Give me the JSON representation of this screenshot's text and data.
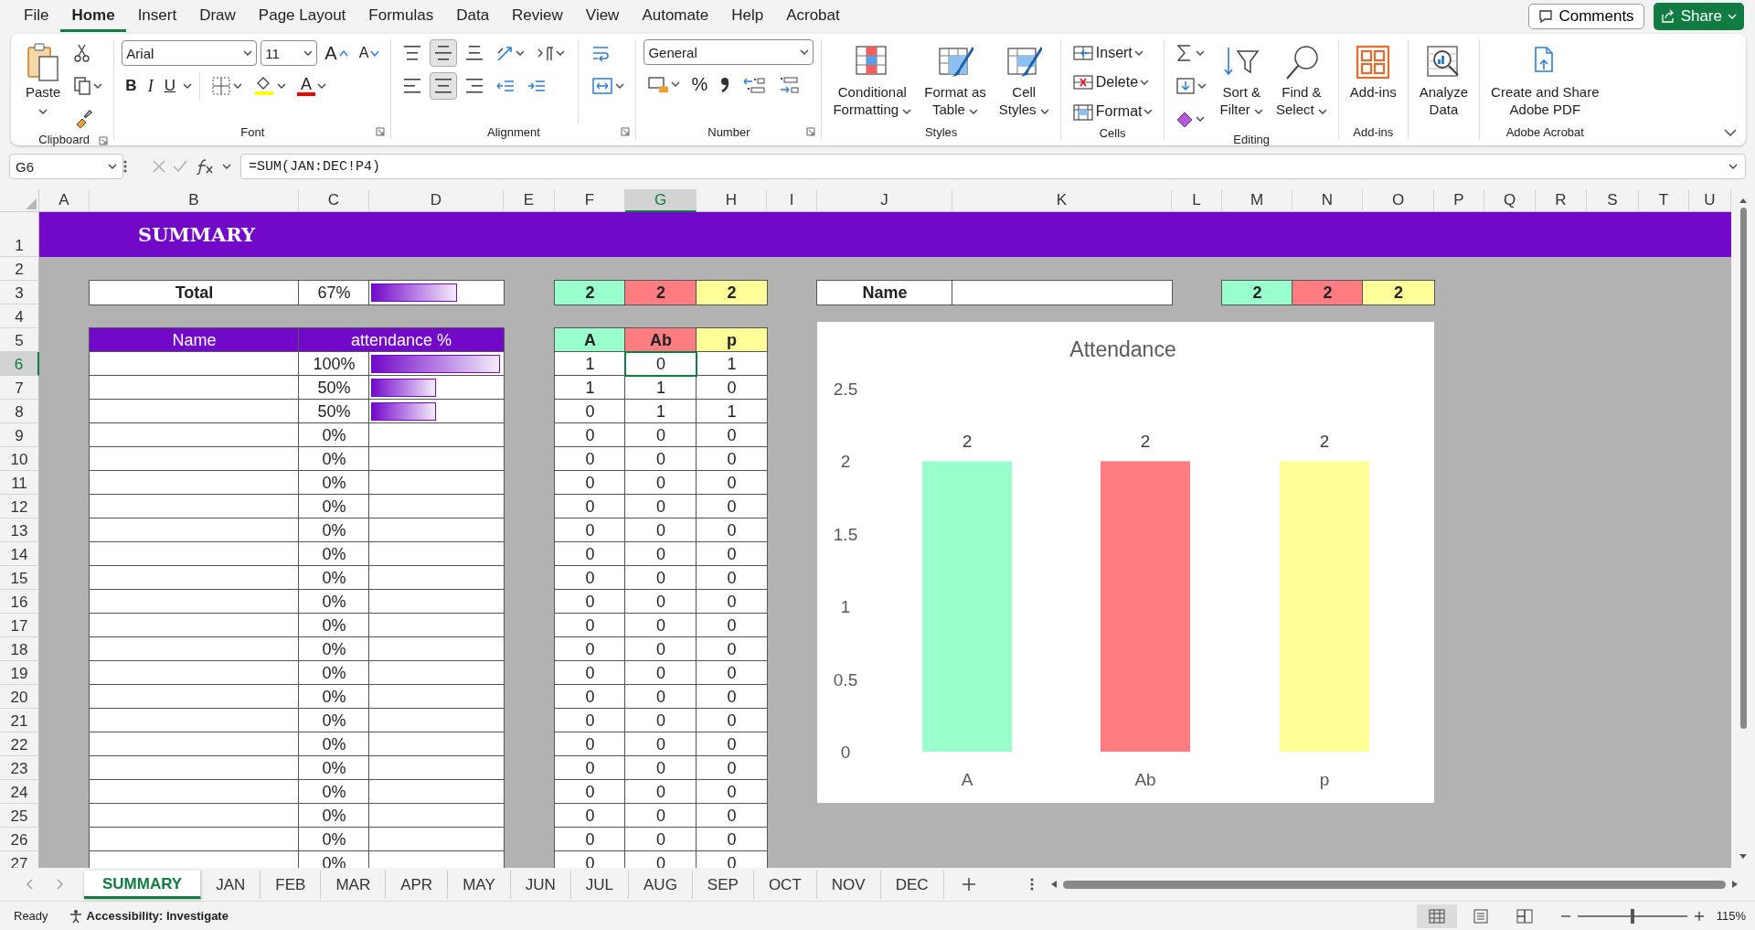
{
  "menu": {
    "tabs": [
      {
        "label": "File",
        "selected": false
      },
      {
        "label": "Home",
        "selected": true
      },
      {
        "label": "Insert",
        "selected": false
      },
      {
        "label": "Draw",
        "selected": false
      },
      {
        "label": "Page Layout",
        "selected": false
      },
      {
        "label": "Formulas",
        "selected": false
      },
      {
        "label": "Data",
        "selected": false
      },
      {
        "label": "Review",
        "selected": false
      },
      {
        "label": "View",
        "selected": false
      },
      {
        "label": "Automate",
        "selected": false
      },
      {
        "label": "Help",
        "selected": false
      },
      {
        "label": "Acrobat",
        "selected": false
      }
    ],
    "comments": "Comments",
    "share": "Share"
  },
  "ribbon": {
    "groups": [
      {
        "kind": "clipboard",
        "label": "Clipboard",
        "launcher": true,
        "paste": "Paste"
      },
      {
        "kind": "font",
        "label": "Font",
        "launcher": true,
        "font": "Arial",
        "size": "11",
        "grow": "A",
        "shrink": "A",
        "styles": [
          "B",
          "I",
          "U"
        ],
        "color_text": "A"
      },
      {
        "kind": "alignment",
        "label": "Alignment",
        "launcher": true,
        "vertical": [
          {
            "selected": false
          },
          {
            "selected": true
          },
          {
            "selected": false
          }
        ],
        "horizontal": [
          {
            "selected": false
          },
          {
            "selected": true
          },
          {
            "selected": false
          }
        ]
      },
      {
        "kind": "number",
        "label": "Number",
        "launcher": true,
        "format": "General",
        "percent": "%"
      },
      {
        "kind": "large",
        "label": "Styles",
        "launcher": false,
        "buttons": [
          {
            "lines": [
              "Conditional",
              "Formatting"
            ],
            "dropdown": true
          },
          {
            "lines": [
              "Format as",
              "Table"
            ],
            "dropdown": true
          },
          {
            "lines": [
              "Cell",
              "Styles"
            ],
            "dropdown": true
          }
        ]
      },
      {
        "kind": "cells",
        "label": "Cells",
        "launcher": false,
        "buttons": [
          {
            "text": "Insert",
            "dropdown": true
          },
          {
            "text": "Delete",
            "dropdown": true
          },
          {
            "text": "Format",
            "dropdown": true
          }
        ]
      },
      {
        "kind": "editing",
        "label": "Editing",
        "launcher": false,
        "buttons": [
          {
            "lines": [
              "Sort &",
              "Filter"
            ],
            "dropdown": true
          },
          {
            "lines": [
              "Find &",
              "Select"
            ],
            "dropdown": true
          }
        ]
      },
      {
        "kind": "large",
        "label": "Add-ins",
        "launcher": false,
        "buttons": [
          {
            "lines": [
              "Add-ins"
            ],
            "dropdown": false
          }
        ]
      },
      {
        "kind": "large",
        "launcher": false,
        "buttons": [
          {
            "lines": [
              "Analyze",
              "Data"
            ],
            "dropdown": false
          }
        ]
      },
      {
        "kind": "large",
        "label": "Adobe Acrobat",
        "launcher": false,
        "buttons": [
          {
            "lines": [
              "Create and Share",
              "Adobe PDF"
            ],
            "dropdown": false
          }
        ]
      }
    ]
  },
  "formula_bar": {
    "name_box": "G6",
    "formula": "=SUM(JAN:DEC!P4)"
  },
  "sheet": {
    "column_headers": [
      {
        "label": "A",
        "selected": false
      },
      {
        "label": "B",
        "selected": false
      },
      {
        "label": "C",
        "selected": false
      },
      {
        "label": "D",
        "selected": false
      },
      {
        "label": "E",
        "selected": false
      },
      {
        "label": "F",
        "selected": false
      },
      {
        "label": "G",
        "selected": true
      },
      {
        "label": "H",
        "selected": false
      },
      {
        "label": "I",
        "selected": false
      },
      {
        "label": "J",
        "selected": false
      },
      {
        "label": "K",
        "selected": false
      },
      {
        "label": "L",
        "selected": false
      },
      {
        "label": "M",
        "selected": false
      },
      {
        "label": "N",
        "selected": false
      },
      {
        "label": "O",
        "selected": false
      },
      {
        "label": "P",
        "selected": false
      },
      {
        "label": "Q",
        "selected": false
      },
      {
        "label": "R",
        "selected": false
      },
      {
        "label": "S",
        "selected": false
      },
      {
        "label": "T",
        "selected": false
      },
      {
        "label": "U",
        "selected": false
      }
    ],
    "row_headers": [
      {
        "label": "1",
        "selected": false
      },
      {
        "label": "2",
        "selected": false
      },
      {
        "label": "3",
        "selected": false
      },
      {
        "label": "4",
        "selected": false
      },
      {
        "label": "5",
        "selected": false
      },
      {
        "label": "6",
        "selected": true
      },
      {
        "label": "7",
        "selected": false
      },
      {
        "label": "8",
        "selected": false
      },
      {
        "label": "9",
        "selected": false
      },
      {
        "label": "10",
        "selected": false
      },
      {
        "label": "11",
        "selected": false
      },
      {
        "label": "12",
        "selected": false
      },
      {
        "label": "13",
        "selected": false
      },
      {
        "label": "14",
        "selected": false
      },
      {
        "label": "15",
        "selected": false
      },
      {
        "label": "16",
        "selected": false
      },
      {
        "label": "17",
        "selected": false
      },
      {
        "label": "18",
        "selected": false
      },
      {
        "label": "19",
        "selected": false
      },
      {
        "label": "20",
        "selected": false
      },
      {
        "label": "21",
        "selected": false
      },
      {
        "label": "22",
        "selected": false
      },
      {
        "label": "23",
        "selected": false
      },
      {
        "label": "24",
        "selected": false
      },
      {
        "label": "25",
        "selected": false
      },
      {
        "label": "26",
        "selected": false
      },
      {
        "label": "27",
        "selected": false
      }
    ],
    "title": "SUMMARY",
    "total": {
      "label": "Total",
      "percent": "67%",
      "level": 0.67
    },
    "totals": [
      "2",
      "2",
      "2"
    ],
    "lookup": {
      "label": "Name",
      "totals": [
        "2",
        "2",
        "2"
      ]
    },
    "table_headers": [
      "Name",
      "attendance %"
    ],
    "legend": [
      {
        "label": "A",
        "color": "#99ffcc"
      },
      {
        "label": "Ab",
        "color": "#ff7c80"
      },
      {
        "label": "p",
        "color": "#ffff99"
      }
    ],
    "rows": [
      {
        "percent": "100%",
        "level": 1,
        "counts": [
          {
            "value": "1",
            "selected": false
          },
          {
            "value": "0",
            "selected": true
          },
          {
            "value": "1",
            "selected": false
          }
        ]
      },
      {
        "percent": "50%",
        "level": 0.5,
        "counts": [
          {
            "value": "1",
            "selected": false
          },
          {
            "value": "1",
            "selected": false
          },
          {
            "value": "0",
            "selected": false
          }
        ]
      },
      {
        "percent": "50%",
        "level": 0.5,
        "counts": [
          {
            "value": "0",
            "selected": false
          },
          {
            "value": "1",
            "selected": false
          },
          {
            "value": "1",
            "selected": false
          }
        ]
      },
      {
        "percent": "0%",
        "counts": [
          {
            "value": "0",
            "selected": false
          },
          {
            "value": "0",
            "selected": false
          },
          {
            "value": "0",
            "selected": false
          }
        ]
      },
      {
        "percent": "0%",
        "counts": [
          {
            "value": "0",
            "selected": false
          },
          {
            "value": "0",
            "selected": false
          },
          {
            "value": "0",
            "selected": false
          }
        ]
      },
      {
        "percent": "0%",
        "counts": [
          {
            "value": "0",
            "selected": false
          },
          {
            "value": "0",
            "selected": false
          },
          {
            "value": "0",
            "selected": false
          }
        ]
      },
      {
        "percent": "0%",
        "counts": [
          {
            "value": "0",
            "selected": false
          },
          {
            "value": "0",
            "selected": false
          },
          {
            "value": "0",
            "selected": false
          }
        ]
      },
      {
        "percent": "0%",
        "counts": [
          {
            "value": "0",
            "selected": false
          },
          {
            "value": "0",
            "selected": false
          },
          {
            "value": "0",
            "selected": false
          }
        ]
      },
      {
        "percent": "0%",
        "counts": [
          {
            "value": "0",
            "selected": false
          },
          {
            "value": "0",
            "selected": false
          },
          {
            "value": "0",
            "selected": false
          }
        ]
      },
      {
        "percent": "0%",
        "counts": [
          {
            "value": "0",
            "selected": false
          },
          {
            "value": "0",
            "selected": false
          },
          {
            "value": "0",
            "selected": false
          }
        ]
      },
      {
        "percent": "0%",
        "counts": [
          {
            "value": "0",
            "selected": false
          },
          {
            "value": "0",
            "selected": false
          },
          {
            "value": "0",
            "selected": false
          }
        ]
      },
      {
        "percent": "0%",
        "counts": [
          {
            "value": "0",
            "selected": false
          },
          {
            "value": "0",
            "selected": false
          },
          {
            "value": "0",
            "selected": false
          }
        ]
      },
      {
        "percent": "0%",
        "counts": [
          {
            "value": "0",
            "selected": false
          },
          {
            "value": "0",
            "selected": false
          },
          {
            "value": "0",
            "selected": false
          }
        ]
      },
      {
        "percent": "0%",
        "counts": [
          {
            "value": "0",
            "selected": false
          },
          {
            "value": "0",
            "selected": false
          },
          {
            "value": "0",
            "selected": false
          }
        ]
      },
      {
        "percent": "0%",
        "counts": [
          {
            "value": "0",
            "selected": false
          },
          {
            "value": "0",
            "selected": false
          },
          {
            "value": "0",
            "selected": false
          }
        ]
      },
      {
        "percent": "0%",
        "counts": [
          {
            "value": "0",
            "selected": false
          },
          {
            "value": "0",
            "selected": false
          },
          {
            "value": "0",
            "selected": false
          }
        ]
      },
      {
        "percent": "0%",
        "counts": [
          {
            "value": "0",
            "selected": false
          },
          {
            "value": "0",
            "selected": false
          },
          {
            "value": "0",
            "selected": false
          }
        ]
      },
      {
        "percent": "0%",
        "counts": [
          {
            "value": "0",
            "selected": false
          },
          {
            "value": "0",
            "selected": false
          },
          {
            "value": "0",
            "selected": false
          }
        ]
      },
      {
        "percent": "0%",
        "counts": [
          {
            "value": "0",
            "selected": false
          },
          {
            "value": "0",
            "selected": false
          },
          {
            "value": "0",
            "selected": false
          }
        ]
      },
      {
        "percent": "0%",
        "counts": [
          {
            "value": "0",
            "selected": false
          },
          {
            "value": "0",
            "selected": false
          },
          {
            "value": "0",
            "selected": false
          }
        ]
      },
      {
        "percent": "0%",
        "counts": [
          {
            "value": "0",
            "selected": false
          },
          {
            "value": "0",
            "selected": false
          },
          {
            "value": "0",
            "selected": false
          }
        ]
      },
      {
        "percent": "0%",
        "counts": [
          {
            "value": "0",
            "selected": false
          },
          {
            "value": "0",
            "selected": false
          },
          {
            "value": "0",
            "selected": false
          }
        ]
      }
    ],
    "chart": {
      "chart_data": {
        "type": "bar",
        "title": "Attendance",
        "categories": [
          "A",
          "Ab",
          "p"
        ],
        "values": [
          2,
          2,
          2
        ],
        "ylim": [
          0,
          2.5
        ],
        "yticks": [
          0,
          0.5,
          1,
          1.5,
          2,
          2.5
        ],
        "data_labels": true
      }
    }
  },
  "sheet_tabs": [
    {
      "label": "SUMMARY",
      "selected": true
    },
    {
      "label": "JAN",
      "selected": false
    },
    {
      "label": "FEB",
      "selected": false
    },
    {
      "label": "MAR",
      "selected": false
    },
    {
      "label": "APR",
      "selected": false
    },
    {
      "label": "MAY",
      "selected": false
    },
    {
      "label": "JUN",
      "selected": false
    },
    {
      "label": "JUL",
      "selected": false
    },
    {
      "label": "AUG",
      "selected": false
    },
    {
      "label": "SEP",
      "selected": false
    },
    {
      "label": "OCT",
      "selected": false
    },
    {
      "label": "NOV",
      "selected": false
    },
    {
      "label": "DEC",
      "selected": false
    }
  ],
  "status_bar": {
    "ready": "Ready",
    "accessibility": "Accessibility: Investigate",
    "views": [
      {
        "selected": true
      },
      {
        "selected": false
      },
      {
        "selected": false
      }
    ],
    "zoom_slider": {
      "level": 0.5
    },
    "zoom": "115%"
  }
}
